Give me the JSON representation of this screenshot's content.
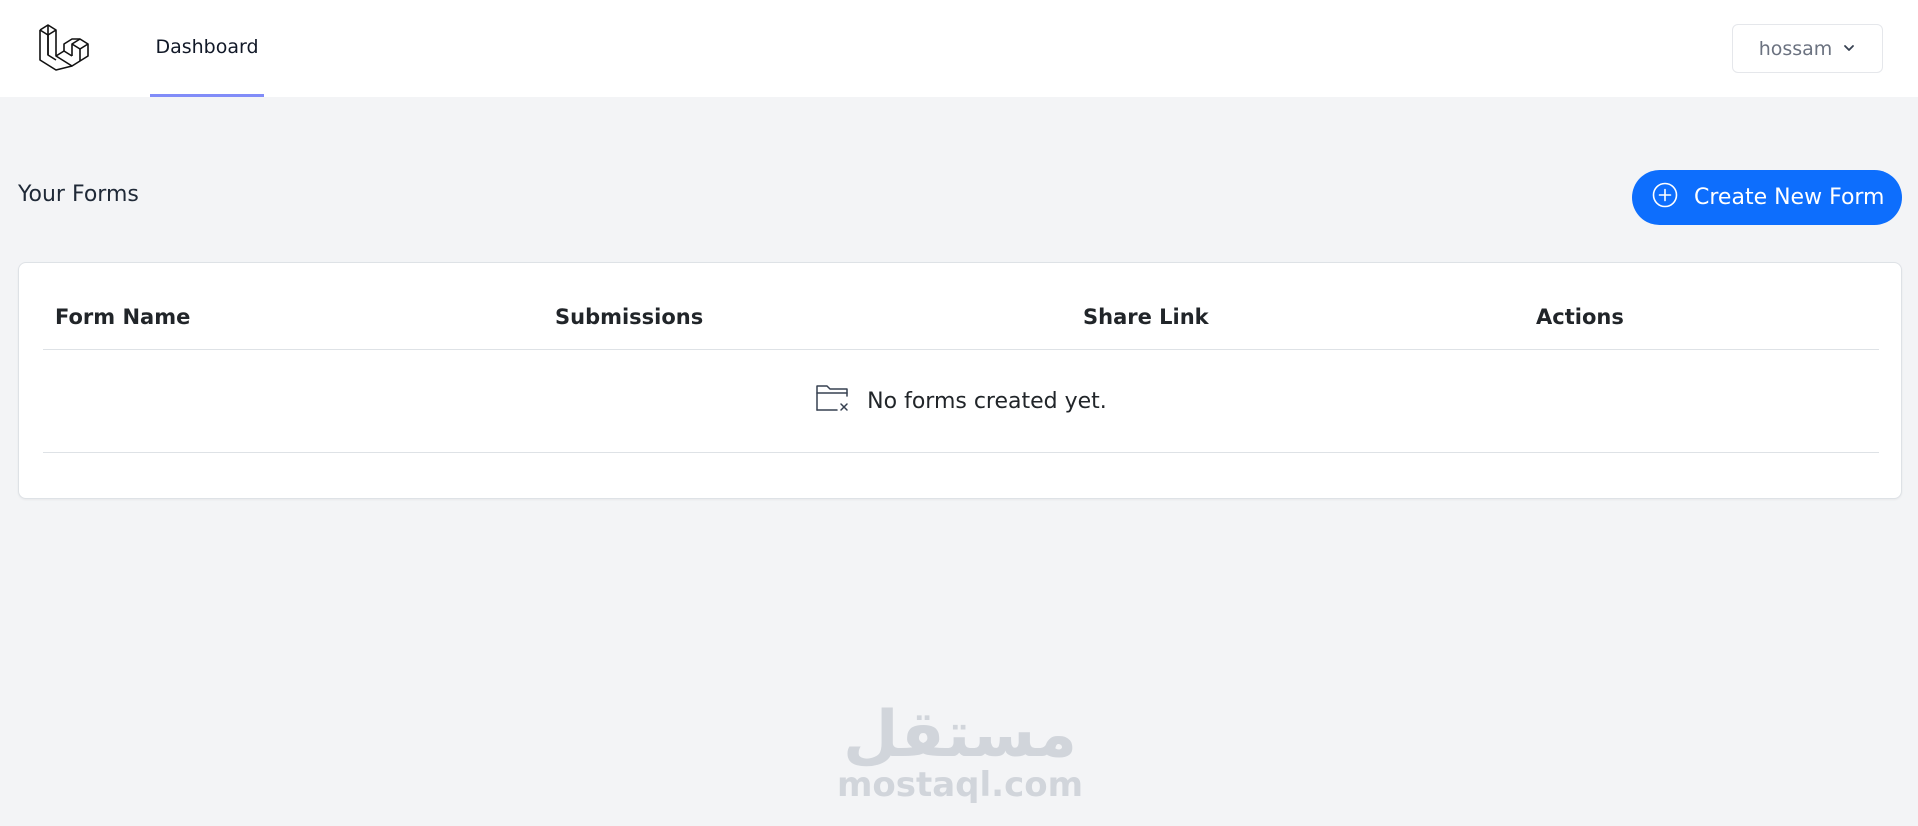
{
  "nav": {
    "logo_icon": "laravel-logo-icon",
    "links": [
      {
        "label": "Dashboard",
        "active": true
      }
    ],
    "user": {
      "name": "hossam",
      "icon": "chevron-down-icon"
    }
  },
  "header": {
    "title": "Your Forms",
    "create_button": {
      "label": "Create New Form",
      "icon": "plus-circle-icon"
    }
  },
  "table": {
    "columns": [
      "Form Name",
      "Submissions",
      "Share Link",
      "Actions"
    ],
    "rows": [],
    "empty_message": "No forms created yet.",
    "empty_icon": "folder-x-icon"
  },
  "watermark": {
    "arabic": "مستقل",
    "latin": "mostaql.com"
  },
  "colors": {
    "accent": "#0d6efd",
    "nav_active_underline": "#818cf8",
    "background": "#f3f4f6"
  }
}
